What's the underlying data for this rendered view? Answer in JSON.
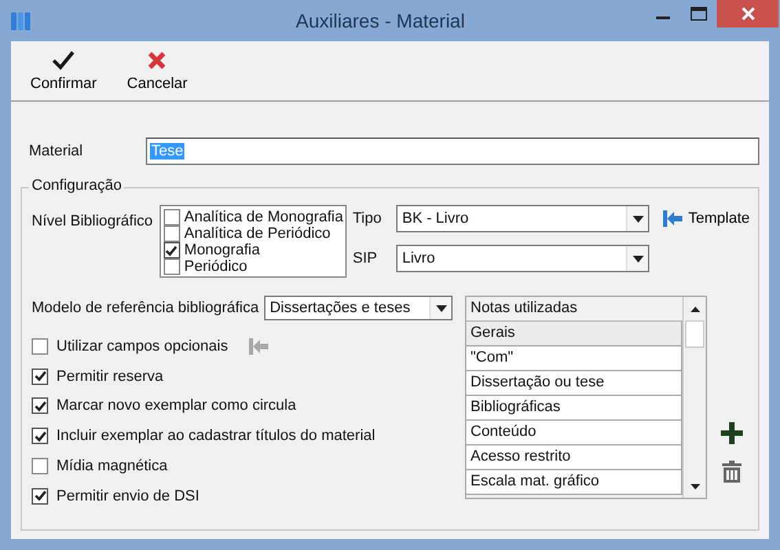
{
  "window": {
    "title": "Auxiliares - Material"
  },
  "toolbar": [
    {
      "kind": "confirm",
      "label": "Confirmar"
    },
    {
      "kind": "cancel",
      "label": "Cancelar"
    }
  ],
  "material": {
    "label": "Material",
    "value": "Tese"
  },
  "configuracao": {
    "title": "Configuração",
    "nivel": {
      "label": "Nível Bibliográfico",
      "options": [
        {
          "label": "Analítica de Monografia",
          "checked": false
        },
        {
          "label": "Analítica de Periódico",
          "checked": false
        },
        {
          "label": "Monografia",
          "checked": true
        },
        {
          "label": "Periódico",
          "checked": false
        }
      ]
    },
    "tipo": {
      "label": "Tipo",
      "value": "BK - Livro"
    },
    "template": {
      "label": "Template"
    },
    "sip": {
      "label": "SIP",
      "value": "Livro"
    },
    "modelo": {
      "label": "Modelo de referência bibliográfica",
      "value": "Dissertações e teses"
    },
    "options": [
      {
        "kind": "with_action",
        "label": "Utilizar campos opcionais",
        "checked": false
      },
      {
        "kind": "plain",
        "label": "Permitir reserva",
        "checked": true
      },
      {
        "kind": "plain",
        "label": "Marcar novo exemplar como circula",
        "checked": true
      },
      {
        "kind": "plain",
        "label": "Incluir exemplar ao cadastrar títulos do material",
        "checked": true
      },
      {
        "kind": "plain",
        "label": "Mídia magnética",
        "checked": false
      },
      {
        "kind": "plain",
        "label": "Permitir envio de DSI",
        "checked": true
      }
    ],
    "notas": {
      "header": "Notas utilizadas",
      "rows": [
        {
          "text": "Gerais",
          "selected": true
        },
        {
          "text": "\"Com\"",
          "selected": false
        },
        {
          "text": "Dissertação ou tese",
          "selected": false
        },
        {
          "text": "Bibliográficas",
          "selected": false
        },
        {
          "text": "Conteúdo",
          "selected": false
        },
        {
          "text": "Acesso restrito",
          "selected": false
        },
        {
          "text": "Escala mat. gráfico",
          "selected": false
        }
      ]
    }
  }
}
